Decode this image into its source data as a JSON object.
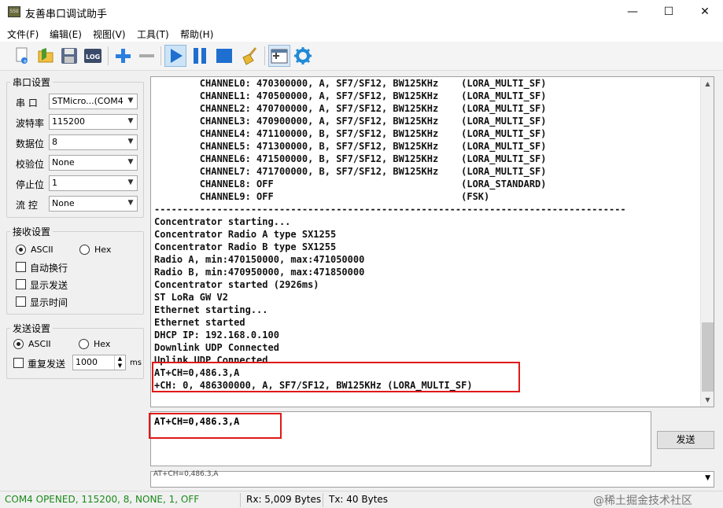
{
  "window": {
    "icon_text": "SSU",
    "title": "友善串口调试助手",
    "minimize_glyph": "—",
    "maximize_glyph": "☐",
    "close_glyph": "✕"
  },
  "menu": [
    "文件(F)",
    "编辑(E)",
    "视图(V)",
    "工具(T)",
    "帮助(H)"
  ],
  "toolbar": {
    "log_label": "LOG",
    "icons": [
      "new-icon",
      "open-icon",
      "save-icon",
      "log-icon",
      "plus-icon",
      "minus-icon",
      "play-icon",
      "pause-icon",
      "stop-icon",
      "clear-broom-icon",
      "add-window-icon",
      "gear-icon"
    ]
  },
  "serial_settings": {
    "title": "串口设置",
    "port_label": "串  口",
    "port_value": "STMicro...(COM4",
    "baud_label": "波特率",
    "baud_value": "115200",
    "databits_label": "数据位",
    "databits_value": "8",
    "parity_label": "校验位",
    "parity_value": "None",
    "stopbits_label": "停止位",
    "stopbits_value": "1",
    "flow_label": "流  控",
    "flow_value": "None"
  },
  "receive_settings": {
    "title": "接收设置",
    "ascii_label": "ASCII",
    "hex_label": "Hex",
    "mode": "ASCII",
    "auto_wrap_label": "自动换行",
    "show_send_label": "显示发送",
    "show_time_label": "显示时间"
  },
  "send_settings": {
    "title": "发送设置",
    "ascii_label": "ASCII",
    "hex_label": "Hex",
    "mode": "ASCII",
    "repeat_label": "重复发送",
    "interval_value": "1000",
    "interval_unit": "ms"
  },
  "receive_lines": [
    "        CHANNEL0: 470300000, A, SF7/SF12, BW125KHz    (LORA_MULTI_SF)",
    "        CHANNEL1: 470500000, A, SF7/SF12, BW125KHz    (LORA_MULTI_SF)",
    "        CHANNEL2: 470700000, A, SF7/SF12, BW125KHz    (LORA_MULTI_SF)",
    "        CHANNEL3: 470900000, A, SF7/SF12, BW125KHz    (LORA_MULTI_SF)",
    "        CHANNEL4: 471100000, B, SF7/SF12, BW125KHz    (LORA_MULTI_SF)",
    "        CHANNEL5: 471300000, B, SF7/SF12, BW125KHz    (LORA_MULTI_SF)",
    "        CHANNEL6: 471500000, B, SF7/SF12, BW125KHz    (LORA_MULTI_SF)",
    "        CHANNEL7: 471700000, B, SF7/SF12, BW125KHz    (LORA_MULTI_SF)",
    "        CHANNEL8: OFF                                 (LORA_STANDARD)",
    "        CHANNEL9: OFF                                 (FSK)",
    "-----------------------------------------------------------------------------------",
    "Concentrator starting...",
    "Concentrator Radio A type SX1255",
    "Concentrator Radio B type SX1255",
    "Radio A, min:470150000, max:471050000",
    "Radio B, min:470950000, max:471850000",
    "Concentrator started (2926ms)",
    "ST LoRa GW V2",
    "Ethernet starting...",
    "Ethernet started",
    "DHCP IP: 192.168.0.100",
    "Downlink UDP Connected",
    "Uplink UDP Connected",
    "AT+CH=0,486.3,A",
    "+CH: 0, 486300000, A, SF7/SF12, BW125KHz (LORA_MULTI_SF)"
  ],
  "send_input_value": "AT+CH=0,486.3,A",
  "send_button_label": "发送",
  "history_value": "AT+CH=0,486.3,A",
  "status": {
    "port": "COM4 OPENED, 115200, 8, NONE, 1, OFF",
    "rx": "Rx: 5,009 Bytes",
    "tx": "Tx: 40 Bytes",
    "watermark": "@稀土掘金技术社区"
  },
  "colors": {
    "status_green": "#1a8a1a",
    "highlight_red": "#e01818",
    "toolbar_blue": "#1e6fd0"
  }
}
